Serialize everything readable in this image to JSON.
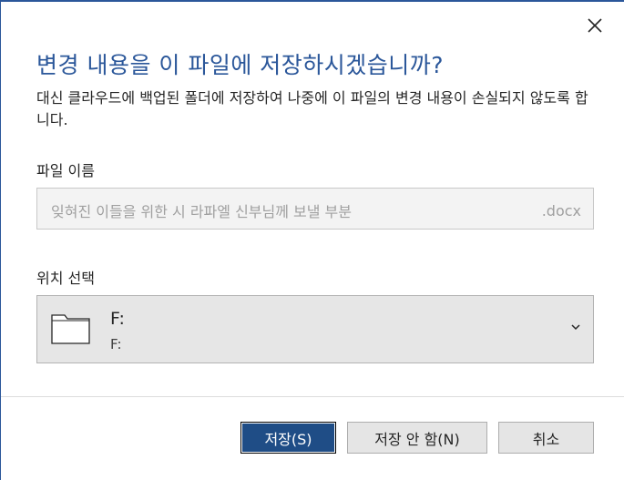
{
  "dialog": {
    "title": "변경 내용을 이 파일에 저장하시겠습니까?",
    "description": "대신 클라우드에 백업된 폴더에 저장하여 나중에 이 파일의 변경 내용이 손실되지 않도록 합니다."
  },
  "filename": {
    "label": "파일 이름",
    "value": "잊혀진 이들을 위한 시 라파엘 신부님께 보낼 부분",
    "extension": ".docx"
  },
  "location": {
    "label": "위치 선택",
    "main": "F:",
    "sub": "F:",
    "icon": "folder-icon"
  },
  "buttons": {
    "save": "저장(S)",
    "dont_save": "저장 안 함(N)",
    "cancel": "취소"
  },
  "icons": {
    "close": "close-icon",
    "chevron": "chevron-down-icon"
  },
  "colors": {
    "accent": "#2b579a",
    "primary_button": "#1f4d86",
    "secondary_button": "#e5e5e5"
  }
}
